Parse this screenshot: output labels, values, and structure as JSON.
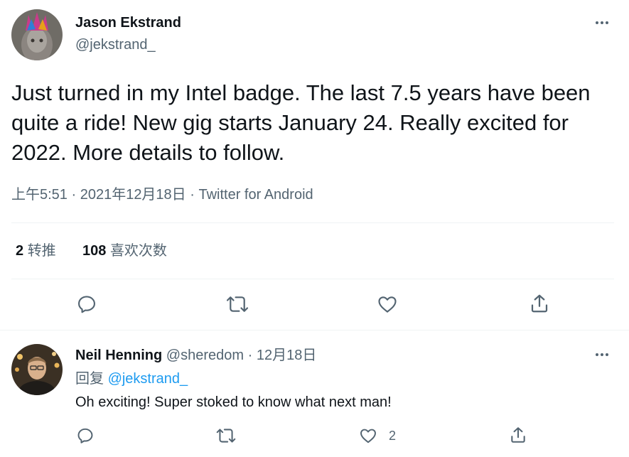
{
  "tweet": {
    "author_name": "Jason Ekstrand",
    "author_handle": "@jekstrand_",
    "text": "Just turned in my Intel badge. The last 7.5 years have been quite a ride! New gig starts January 24. Really excited for 2022. More details to follow.",
    "timestamp": "上午5:51 · 2021年12月18日 · Twitter for Android",
    "retweets_count": "2",
    "retweets_label": "转推",
    "likes_count": "108",
    "likes_label": "喜欢次数",
    "actions": [
      "reply-icon",
      "retweet-icon",
      "like-icon",
      "share-icon"
    ]
  },
  "reply": {
    "author_name": "Neil Henning",
    "author_handle": "@sheredom",
    "separator": "·",
    "date": "12月18日",
    "replying_to_label": "回复",
    "replying_to_handle": "@jekstrand_",
    "text": "Oh exciting! Super stoked to know what next man!",
    "like_count": "2",
    "actions": [
      "reply-icon",
      "retweet-icon",
      "like-icon",
      "share-icon"
    ]
  },
  "colors": {
    "text": "#0f1419",
    "muted": "#536471",
    "link": "#1d9bf0",
    "divider": "#eff3f4"
  }
}
